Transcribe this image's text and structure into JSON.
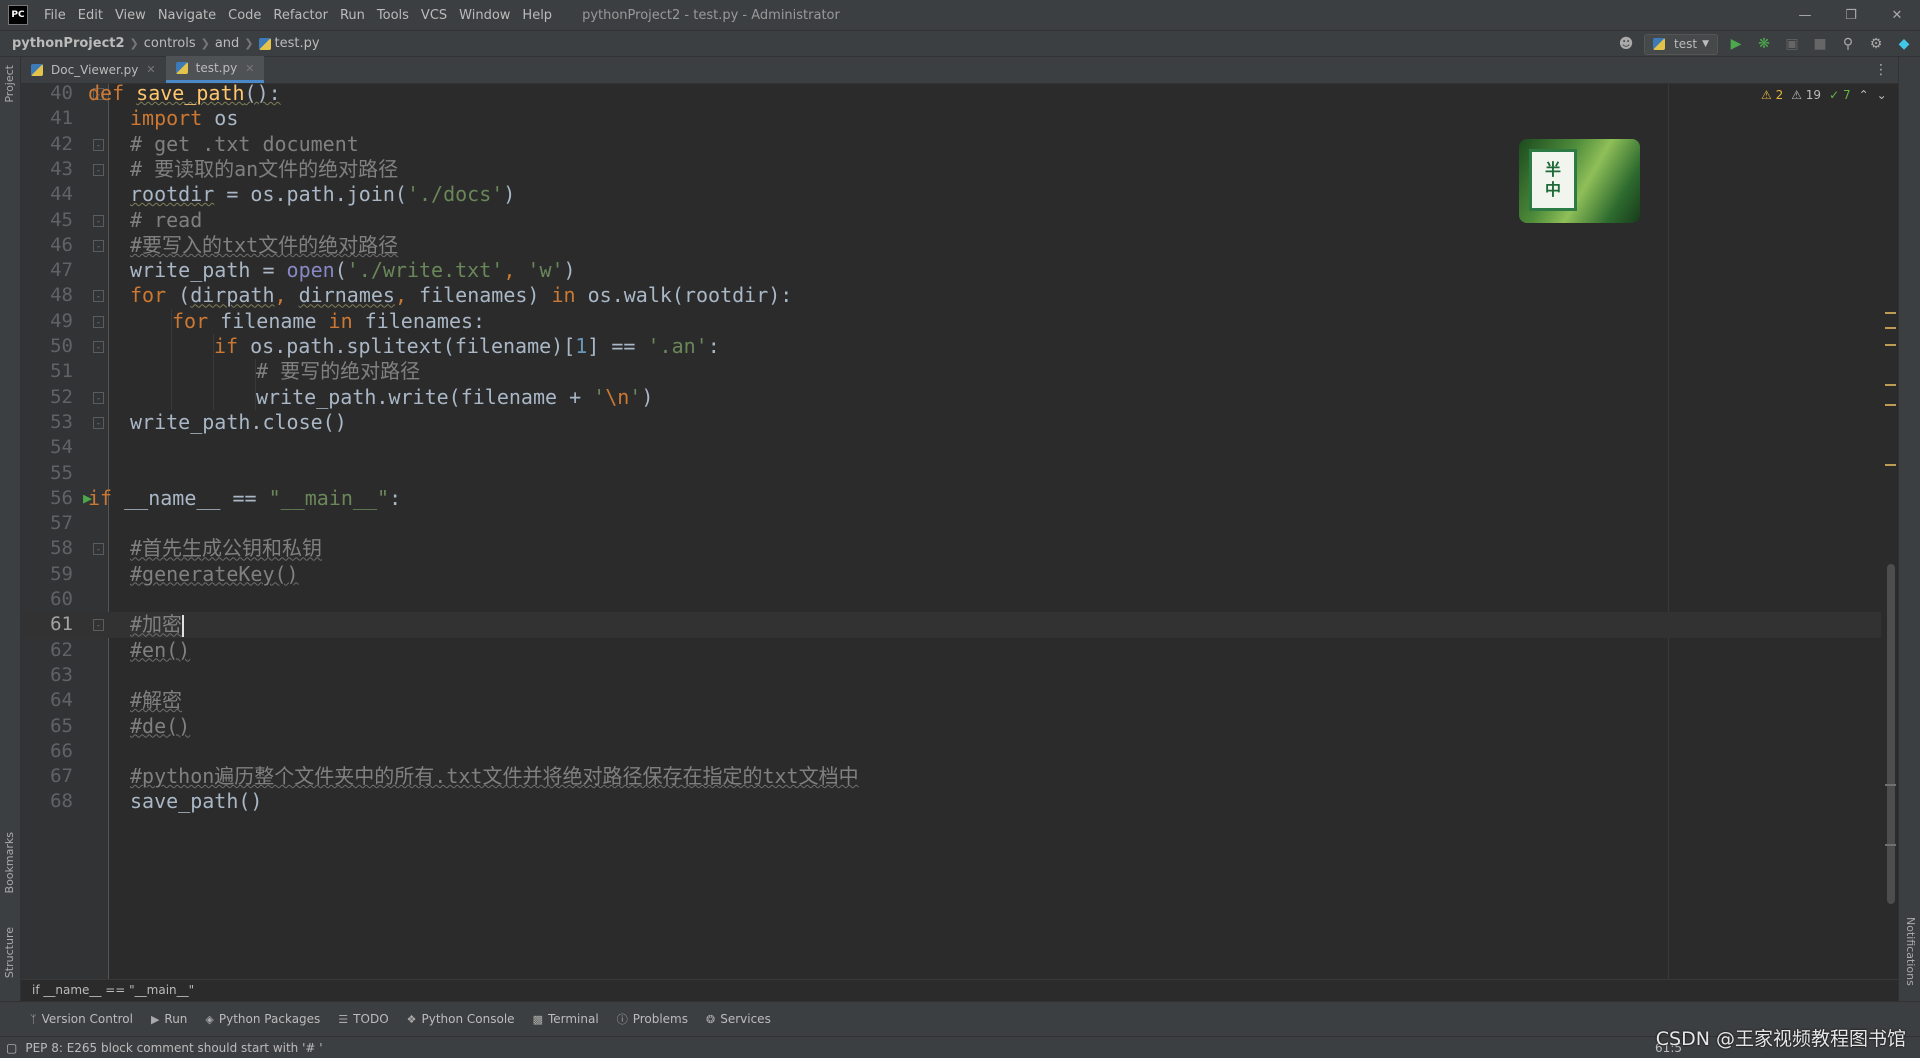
{
  "titlebar": {
    "logo": "PC",
    "menu": [
      "File",
      "Edit",
      "View",
      "Navigate",
      "Code",
      "Refactor",
      "Run",
      "Tools",
      "VCS",
      "Window",
      "Help"
    ],
    "window_title": "pythonProject2 - test.py - Administrator"
  },
  "navbar": {
    "project": "pythonProject2",
    "crumbs": [
      "controls",
      "and"
    ],
    "file": "test.py",
    "run_config": "test"
  },
  "tabs": [
    {
      "label": "Doc_Viewer.py",
      "active": false
    },
    {
      "label": "test.py",
      "active": true
    }
  ],
  "left_strip": {
    "project": "Project",
    "bookmarks": "Bookmarks",
    "structure": "Structure"
  },
  "right_strip": {
    "notifications": "Notifications"
  },
  "inspection": {
    "warnings": "2",
    "weak_warnings": "19",
    "ok": "7"
  },
  "sticker": {
    "top": "半",
    "bottom": "中"
  },
  "code_lines": [
    {
      "n": "40",
      "indent": 0,
      "html": "<span class=\"kw\">def</span> <span class=\"fn ul-wavy\">save_path</span><span class=\"ul-wavy\">():</span>"
    },
    {
      "n": "41",
      "indent": 1,
      "html": "<span class=\"kw\">import</span> os"
    },
    {
      "n": "42",
      "indent": 1,
      "html": "<span class=\"cm\"># get .txt document</span>"
    },
    {
      "n": "43",
      "indent": 1,
      "html": "<span class=\"cm\"># 要读取的an文件的绝对路径</span>"
    },
    {
      "n": "44",
      "indent": 1,
      "html": "<span class=\"ul-wavy\">rootdir</span> = os.path.join(<span class=\"str\">'./docs'</span>)"
    },
    {
      "n": "45",
      "indent": 1,
      "html": "<span class=\"cm\"># read</span>"
    },
    {
      "n": "46",
      "indent": 1,
      "html": "<span class=\"cm-u\">#要写入的txt文件的绝对路径</span>"
    },
    {
      "n": "47",
      "indent": 1,
      "html": "write_path = <span class=\"bi\">open</span>(<span class=\"str\">'./write.txt'</span><span class=\"kw\">,</span> <span class=\"str\">'w'</span>)"
    },
    {
      "n": "48",
      "indent": 1,
      "html": "<span class=\"kw\">for</span> (<span class=\"ul-wavy\">dirpath</span><span class=\"kw\">,</span> <span class=\"ul-wavy\">dirnames</span><span class=\"kw\">,</span> filenames) <span class=\"kw\">in</span> os.walk(rootdir):"
    },
    {
      "n": "49",
      "indent": 2,
      "html": "<span class=\"kw\">for</span> filename <span class=\"kw\">in</span> filenames:"
    },
    {
      "n": "50",
      "indent": 3,
      "html": "<span class=\"kw\">if</span> os.path.splitext(filename)[<span class=\"num\">1</span>] == <span class=\"str\">'.an'</span>:"
    },
    {
      "n": "51",
      "indent": 4,
      "html": "<span class=\"cm\"># 要写的绝对路径</span>"
    },
    {
      "n": "52",
      "indent": 4,
      "html": "write_path.write(filename + <span class=\"str\">'</span><span class=\"kw\">\\n</span><span class=\"str\">'</span>)"
    },
    {
      "n": "53",
      "indent": 1,
      "html": "write_path.close()"
    },
    {
      "n": "54",
      "indent": 0,
      "html": ""
    },
    {
      "n": "55",
      "indent": 0,
      "html": ""
    },
    {
      "n": "56",
      "indent": 0,
      "html": "<span class=\"kw\">if</span> __name__ == <span class=\"str\">\"__main__\"</span>:"
    },
    {
      "n": "57",
      "indent": 0,
      "html": ""
    },
    {
      "n": "58",
      "indent": 1,
      "html": "<span class=\"cm-u\">#首先生成公钥和私钥</span>"
    },
    {
      "n": "59",
      "indent": 1,
      "html": "<span class=\"cm-u\">#generateKey()</span>"
    },
    {
      "n": "60",
      "indent": 0,
      "html": ""
    },
    {
      "n": "61",
      "indent": 1,
      "html": "<span class=\"cm-u\">#加密</span><span class=\"caret\"></span>"
    },
    {
      "n": "62",
      "indent": 1,
      "html": "<span class=\"cm-u\">#en()</span>"
    },
    {
      "n": "63",
      "indent": 0,
      "html": ""
    },
    {
      "n": "64",
      "indent": 1,
      "html": "<span class=\"cm-u\">#解密</span>"
    },
    {
      "n": "65",
      "indent": 1,
      "html": "<span class=\"cm-u\">#de()</span>"
    },
    {
      "n": "66",
      "indent": 0,
      "html": ""
    },
    {
      "n": "67",
      "indent": 1,
      "html": "<span class=\"cm-u\">#python遍历整个文件夹中的所有.txt文件并将绝对路径保存在指定的txt文档中</span>"
    },
    {
      "n": "68",
      "indent": 1,
      "html": "save_path()"
    }
  ],
  "breadcrumb_bar": "if __name__ == \"__main__\"",
  "toolwindows": [
    "Version Control",
    "Run",
    "Python Packages",
    "TODO",
    "Python Console",
    "Terminal",
    "Problems",
    "Services"
  ],
  "status": {
    "message": "PEP 8: E265 block comment should start with '# '",
    "position": "61:5"
  },
  "watermark": "CSDN @王家视频教程图书馆",
  "colors": {
    "keyword": "#cc7832",
    "function": "#ffc66d",
    "string": "#6a8759",
    "comment": "#808080",
    "accent": "#4a88c7"
  }
}
